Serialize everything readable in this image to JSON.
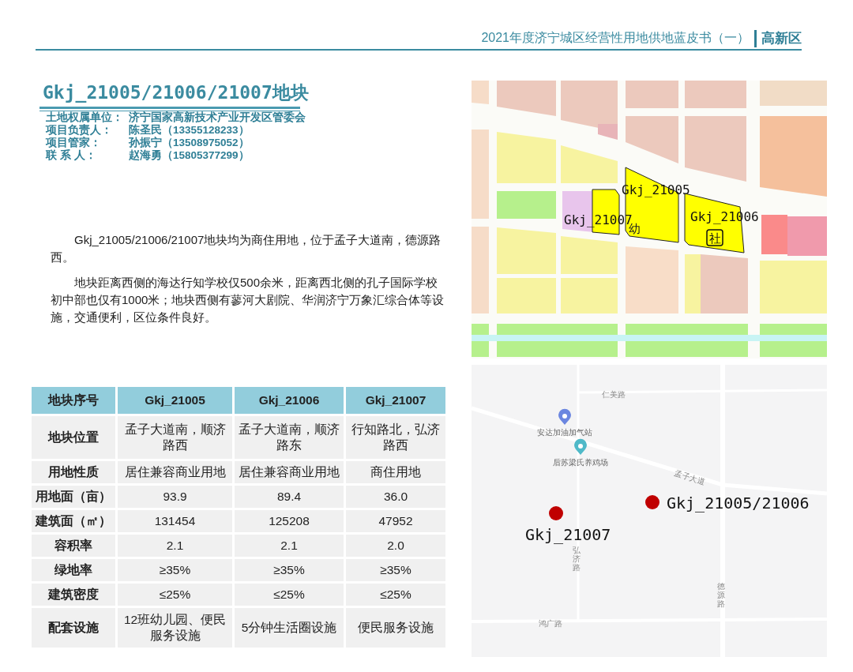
{
  "header": {
    "title": "2021年度济宁城区经营性用地供地蓝皮书（一）",
    "section": "高新区"
  },
  "plot": {
    "title": "Gkj_21005/21006/21007地块",
    "info": [
      {
        "label": "土地权属单位：",
        "value": "济宁国家高新技术产业开发区管委会"
      },
      {
        "label": "项目负责人：",
        "value": "陈圣民（13355128233）"
      },
      {
        "label": "项目管家：",
        "value": "孙振宁（13508975052）"
      },
      {
        "label": "联 系 人：",
        "value": "赵海勇（15805377299）"
      }
    ],
    "paragraphs": [
      "Gkj_21005/21006/21007地块均为商住用地，位于孟子大道南，德源路西。",
      "地块距离西侧的海达行知学校仅500余米，距离西北侧的孔子国际学校初中部也仅有1000米；地块西侧有蓼河大剧院、华润济宁万象汇综合体等设施，交通便利，区位条件良好。"
    ]
  },
  "table": {
    "columns": [
      "地块序号",
      "Gkj_21005",
      "Gkj_21006",
      "Gkj_21007"
    ],
    "rows": [
      [
        "地块位置",
        "孟子大道南，顺济路西",
        "孟子大道南，顺济路东",
        "行知路北，弘济路西"
      ],
      [
        "用地性质",
        "居住兼容商业用地",
        "居住兼容商业用地",
        "商住用地"
      ],
      [
        "用地面（亩）",
        "93.9",
        "89.4",
        "36.0"
      ],
      [
        "建筑面（㎡）",
        "131454",
        "125208",
        "47952"
      ],
      [
        "容积率",
        "2.1",
        "2.1",
        "2.0"
      ],
      [
        "绿地率",
        "≥35%",
        "≥35%",
        "≥35%"
      ],
      [
        "建筑密度",
        "≤25%",
        "≤25%",
        "≤25%"
      ],
      [
        "配套设施",
        "12班幼儿园、便民服务设施",
        "5分钟生活圈设施",
        "便民服务设施"
      ]
    ]
  },
  "plan_map": {
    "labels": [
      {
        "text": "Gkj_21005",
        "kind": "plot"
      },
      {
        "text": "Gkj_21007",
        "kind": "plot"
      },
      {
        "text": "Gkj_21006",
        "kind": "plot"
      },
      {
        "text": "幼",
        "kind": "facility"
      },
      {
        "text": "社",
        "kind": "facility-boxed"
      }
    ]
  },
  "location_map": {
    "roads": [
      {
        "name": "仁美路",
        "kind": "horizontal"
      },
      {
        "name": "孟子大道",
        "kind": "diagonal"
      },
      {
        "name": "弘济路",
        "kind": "vertical"
      },
      {
        "name": "德源路",
        "kind": "vertical"
      },
      {
        "name": "鸿广路",
        "kind": "horizontal"
      }
    ],
    "pois": [
      {
        "name": "安达加油加气站",
        "kind": "fuel"
      },
      {
        "name": "后苏梁氏养鸡场",
        "kind": "farm"
      }
    ],
    "markers": [
      {
        "label": "Gkj_21005/21006"
      },
      {
        "label": "Gkj_21007"
      }
    ]
  }
}
